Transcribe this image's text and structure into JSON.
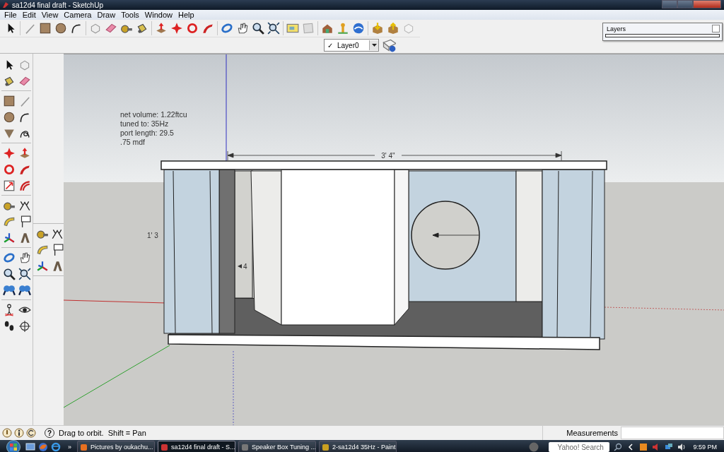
{
  "window": {
    "title": "sa12d4 final draft - SketchUp"
  },
  "menu": [
    "File",
    "Edit",
    "View",
    "Camera",
    "Draw",
    "Tools",
    "Window",
    "Help"
  ],
  "layer_select": {
    "mark": "✓",
    "value": "Layer0"
  },
  "layers_panel": {
    "title": "Layers"
  },
  "viewport": {
    "note": [
      "net volume: 1.22ftcu",
      "tuned to: 35Hz",
      "port length: 29.5",
      ".75 mdf"
    ],
    "width_dimension": "3' 4\"",
    "height_dimension": "1' 3",
    "depth_dimension": "4"
  },
  "status_bar": {
    "help_glyph": "?",
    "hint": "Drag to orbit.  Shift = Pan",
    "measurements_label": "Measurements"
  },
  "taskbar": {
    "more": "»",
    "tasks": [
      {
        "label": "Pictures by oukachu...",
        "selected": false
      },
      {
        "label": "sa12d4 final draft - S...",
        "selected": true
      },
      {
        "label": "Speaker Box Tuning ...",
        "selected": false
      },
      {
        "label": "2-sa12d4 35Hz - Paint",
        "selected": false
      }
    ],
    "search_placeholder": "Yahoo! Search",
    "clock": "9:59 PM"
  }
}
